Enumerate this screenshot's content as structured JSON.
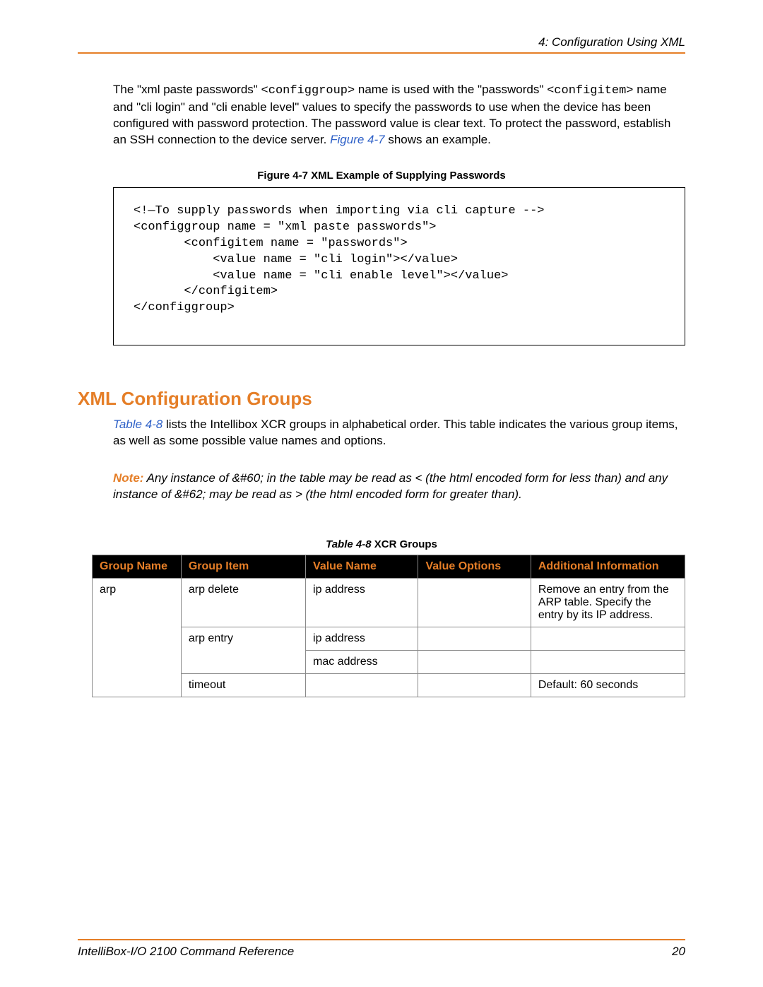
{
  "header": {
    "chapter": "4: Configuration Using XML"
  },
  "paragraph1": {
    "seg1": "The \"xml paste passwords\" ",
    "code1": "<configgroup>",
    "seg2": " name is used with the \"passwords\" ",
    "code2": "<configitem>",
    "seg3": " name and \"cli login\" and \"cli enable level\" values to specify the passwords to use when the device has been configured with password protection. The password value is clear text. To protect the password, establish an SSH connection to the device server. ",
    "link": "Figure 4-7",
    "seg4": " shows an example."
  },
  "figure": {
    "caption": "Figure 4-7  XML Example of Supplying Passwords",
    "code": "<!—To supply passwords when importing via cli capture -->\n<configgroup name = \"xml paste passwords\">\n       <configitem name = \"passwords\">\n           <value name = \"cli login\"></value>\n           <value name = \"cli enable level\"></value>\n       </configitem>\n</configgroup>"
  },
  "section": {
    "heading": "XML Configuration Groups",
    "paraA_link": "Table 4-8",
    "paraA_text": " lists the Intellibox XCR groups in alphabetical order. This table indicates the various group items, as well as some possible value names and options.",
    "note_label": "Note:",
    "note_text": "   Any instance of &#60; in the table may be read as < (the html encoded form for less than) and any instance of &#62; may be read as > (the html encoded form for greater than)."
  },
  "table": {
    "caption_prefix": "Table 4-8",
    "caption_rest": "  XCR Groups",
    "headers": [
      "Group Name",
      "Group Item",
      "Value Name",
      "Value Options",
      "Additional Information"
    ],
    "rows": [
      {
        "gn": "arp",
        "gi": "arp delete",
        "vn": "ip address",
        "vo": "",
        "ai": "Remove an entry from the ARP table. Specify the entry by its IP address."
      },
      {
        "gn": "",
        "gi": "arp entry",
        "vn": "ip address",
        "vo": "",
        "ai": ""
      },
      {
        "gn": "",
        "gi": "",
        "vn": "mac address",
        "vo": "",
        "ai": ""
      },
      {
        "gn": "",
        "gi": "timeout",
        "vn": "",
        "vo": "",
        "ai": "Default: 60 seconds"
      }
    ]
  },
  "footer": {
    "doc": "IntelliBox-I/O 2100 Command Reference",
    "page": "20"
  }
}
